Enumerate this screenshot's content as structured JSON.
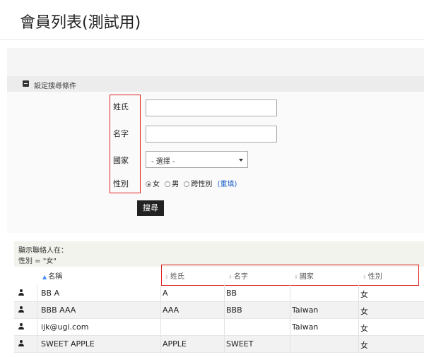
{
  "page": {
    "title": "會員列表(測試用)"
  },
  "search_panel": {
    "header": "設定搜尋條件",
    "labels": {
      "surname": "姓氏",
      "given": "名字",
      "country": "國家",
      "gender": "性別"
    },
    "inputs": {
      "surname": "",
      "given": ""
    },
    "country_select": {
      "selected": "- 選擇 -"
    },
    "gender": {
      "options": [
        "女",
        "男",
        "跨性別"
      ],
      "selected": "女",
      "reset_open": "(",
      "reset_label": "重填",
      "reset_close": ")"
    },
    "search_button": "搜尋"
  },
  "filter_summary": {
    "line1": "顯示聯絡人在：",
    "line2": "性別 = \"女\""
  },
  "table": {
    "columns": [
      "名稱",
      "姓氏",
      "名字",
      "國家",
      "性別"
    ],
    "rows": [
      {
        "name": "BB A",
        "surname": "A",
        "given": "BB",
        "country": "",
        "gender": "女"
      },
      {
        "name": "BBB AAA",
        "surname": "AAA",
        "given": "BBB",
        "country": "Taiwan",
        "gender": "女"
      },
      {
        "name": "ijk@ugi.com",
        "surname": "",
        "given": "",
        "country": "Taiwan",
        "gender": "女"
      },
      {
        "name": "SWEET APPLE",
        "surname": "APPLE",
        "given": "SWEET",
        "country": "",
        "gender": "女"
      }
    ]
  },
  "colors": {
    "highlight": "#e02020",
    "link": "#2266cc",
    "button": "#222222"
  }
}
